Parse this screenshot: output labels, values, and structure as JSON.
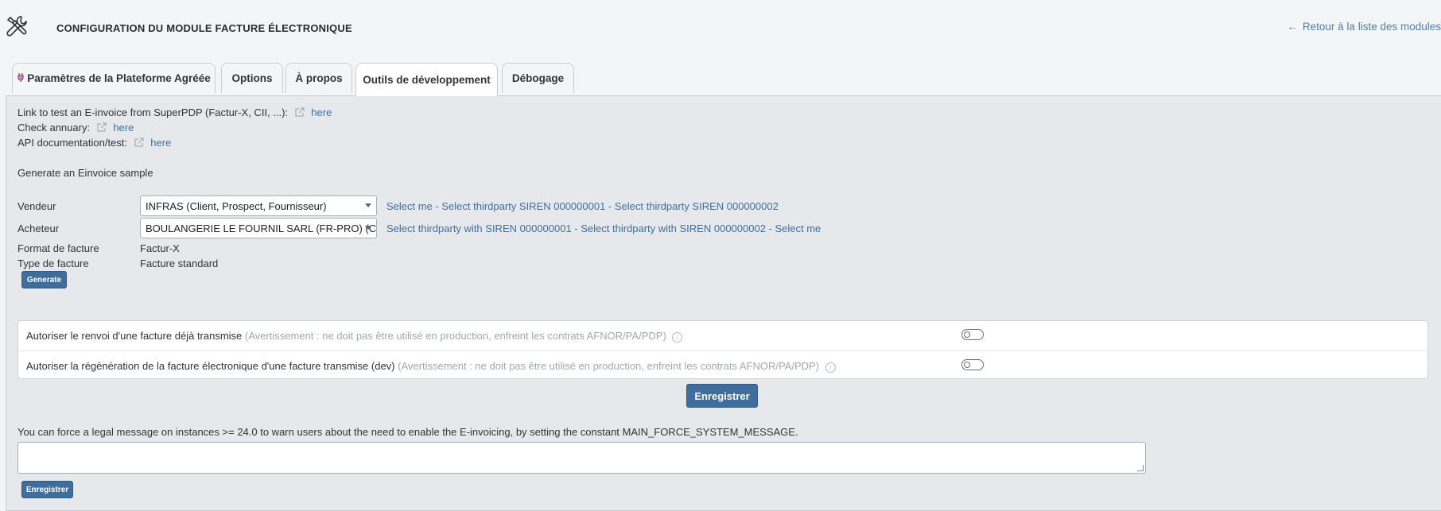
{
  "header": {
    "icon": "tools-icon",
    "title": "CONFIGURATION DU MODULE FACTURE ÉLECTRONIQUE",
    "back_arrow": "←",
    "back_link": "Retour à la liste des modules"
  },
  "tabs": [
    {
      "label": "Paramètres de la Plateforme Agréée",
      "icon": "plugin-icon",
      "active": false
    },
    {
      "label": "Options",
      "active": false
    },
    {
      "label": "À propos",
      "active": false
    },
    {
      "label": "Outils de développement",
      "active": true
    },
    {
      "label": "Débogage",
      "active": false
    }
  ],
  "links": [
    {
      "label": "Link to test an E-invoice from SuperPDP (Factur-X, CII, ...):",
      "link_text": "here",
      "icon": "external-link-icon"
    },
    {
      "label": "Check annuary:",
      "link_text": "here",
      "icon": "external-link-icon"
    },
    {
      "label": "API documentation/test:",
      "link_text": "here",
      "icon": "external-link-icon"
    }
  ],
  "sample": {
    "heading": "Generate an Einvoice sample",
    "vendeur_label": "Vendeur",
    "vendeur_value": "INFRAS (Client, Prospect, Fournisseur)",
    "vendeur_links": "Select me - Select thirdparty SIREN 000000001 - Select thirdparty SIREN 000000002",
    "acheteur_label": "Acheteur",
    "acheteur_value": "BOULANGERIE LE FOURNIL SARL (FR-PRO) (C...",
    "acheteur_links": "Select thirdparty with SIREN 000000001 - Select thirdparty with SIREN 000000002 - Select me",
    "format_label": "Format de facture",
    "format_value": "Factur-X",
    "type_label": "Type de facture",
    "type_value": "Facture standard",
    "generate_button": "Generate"
  },
  "options": [
    {
      "label": "Autoriser le renvoi d'une facture déjà transmise",
      "warning": "(Avertissement : ne doit pas être utilisé en production, enfreint les contrats AFNOR/PA/PDP)",
      "enabled": false
    },
    {
      "label": "Autoriser la régénération de la facture électronique d'une facture transmise (dev)",
      "warning": "(Avertissement : ne doit pas être utilisé en production, enfreint les contrats AFNOR/PA/PDP)",
      "enabled": false
    }
  ],
  "info_glyph": "i",
  "save_button": "Enregistrer",
  "legal": {
    "text": "You can force a legal message on instances >= 24.0 to warn users about the need to enable the E-invoicing, by setting the constant MAIN_FORCE_SYSTEM_MESSAGE.",
    "textarea_value": "",
    "save_button": "Enregistrer"
  },
  "colors": {
    "link": "#3d6fa3",
    "button": "#3e6e9e",
    "panel_bg": "#e6e8ec"
  }
}
